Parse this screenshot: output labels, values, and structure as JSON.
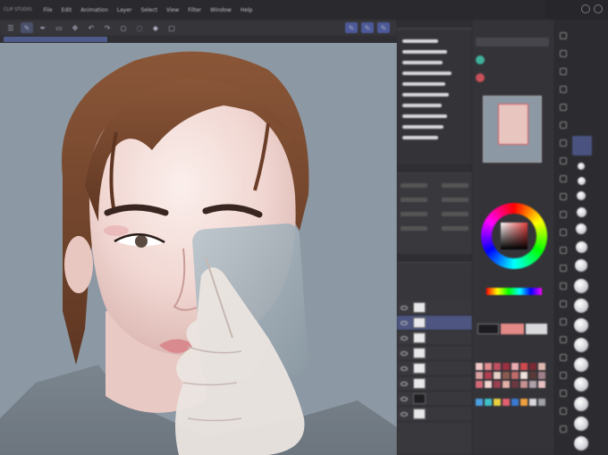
{
  "app": {
    "window_title": "CLIP STUDIO",
    "menu": [
      "File",
      "Edit",
      "Animation",
      "Layer",
      "Select",
      "View",
      "Filter",
      "Window",
      "Help"
    ]
  },
  "toolbar": {
    "icons": [
      "menu-icon",
      "brush-icon",
      "pen-icon",
      "eraser-icon",
      "move-icon",
      "undo-icon",
      "redo-icon",
      "circle-icon",
      "lasso-icon",
      "fill-icon",
      "transform-icon"
    ]
  },
  "colors": {
    "canvas_bg": "#8c98a3",
    "panel_bg": "#38383d",
    "accent": "#4d5a9a",
    "hair": "#7a4a30",
    "skin": "#f3dcd6",
    "lips": "#d98a8e"
  }
}
